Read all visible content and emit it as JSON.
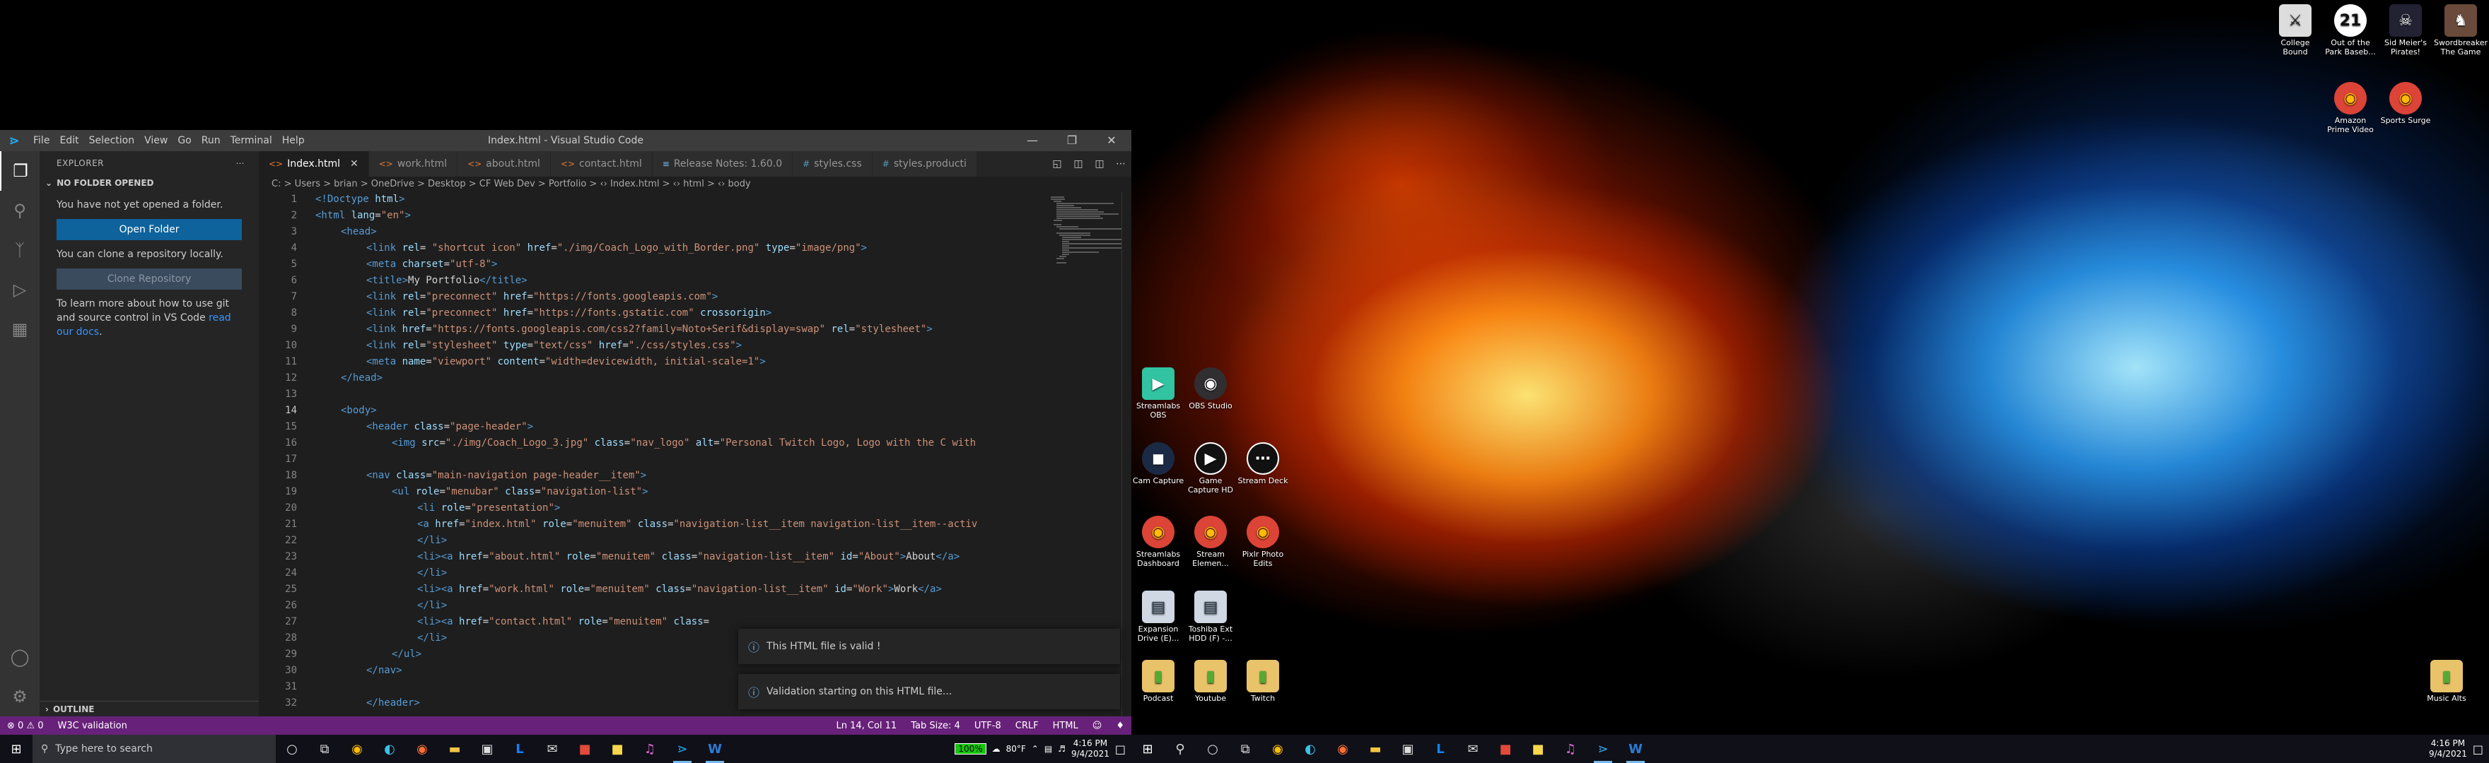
{
  "vscode": {
    "window_title": "Index.html - Visual Studio Code",
    "menu": [
      "File",
      "Edit",
      "Selection",
      "View",
      "Go",
      "Run",
      "Terminal",
      "Help"
    ],
    "explorer": {
      "header": "EXPLORER",
      "section": "NO FOLDER OPENED",
      "msg1": "You have not yet opened a folder.",
      "open_folder": "Open Folder",
      "msg2": "You can clone a repository locally.",
      "clone_repo": "Clone Repository",
      "msg3a": "To learn more about how to use git and source control in VS Code ",
      "msg3_link": "read our docs",
      "msg3b": ".",
      "outline": "OUTLINE"
    },
    "tabs": [
      {
        "label": "Index.html",
        "active": true
      },
      {
        "label": "work.html",
        "active": false
      },
      {
        "label": "about.html",
        "active": false
      },
      {
        "label": "contact.html",
        "active": false
      },
      {
        "label": "Release Notes: 1.60.0",
        "active": false
      },
      {
        "label": "styles.css",
        "active": false
      },
      {
        "label": "styles.producti",
        "active": false
      }
    ],
    "breadcrumb": "C: > Users > brian > OneDrive > Desktop > CF Web Dev > Portfolio > ‹› Index.html > ‹› html > ‹› body",
    "line_numbers": [
      "1",
      "2",
      "3",
      "4",
      "5",
      "6",
      "7",
      "8",
      "9",
      "10",
      "11",
      "12",
      "13",
      "14",
      "15",
      "16",
      "17",
      "18",
      "19",
      "20",
      "21",
      "22",
      "23",
      "24",
      "25",
      "26",
      "27",
      "28",
      "29",
      "30",
      "31",
      "32"
    ],
    "toasts": [
      "This HTML file is valid !",
      "Validation starting on this HTML file..."
    ],
    "status": {
      "problems": "⊗ 0 ⚠ 0",
      "w3c": "W3C validation",
      "position": "Ln 14, Col 11",
      "tab_size": "Tab Size: 4",
      "encoding": "UTF-8",
      "eol": "CRLF",
      "language": "HTML"
    }
  },
  "taskbar": {
    "search_placeholder": "Type here to search",
    "battery": "100%",
    "weather": "80°F",
    "time": "4:16 PM",
    "date": "9/4/2021"
  },
  "desktop_icons_top": [
    {
      "label": "College Bound"
    },
    {
      "label": "Out of the Park Baseb...",
      "badge": "21"
    },
    {
      "label": "Sid Meier's Pirates!"
    },
    {
      "label": "Swordbreaker The Game"
    },
    {
      "label": "Amazon Prime Video"
    },
    {
      "label": "Sports Surge"
    }
  ],
  "desktop_icons_left": [
    {
      "label": "Streamlabs OBS"
    },
    {
      "label": "OBS Studio"
    },
    {
      "label": "Cam Capture"
    },
    {
      "label": "Game Capture HD"
    },
    {
      "label": "Stream Deck"
    },
    {
      "label": "Streamlabs Dashboard"
    },
    {
      "label": "Stream Elemen..."
    },
    {
      "label": "Pixlr Photo Edits"
    },
    {
      "label": "Expansion Drive (E)..."
    },
    {
      "label": "Toshiba Ext HDD (F) -..."
    },
    {
      "label": "Podcast"
    },
    {
      "label": "Youtube"
    },
    {
      "label": "Twitch"
    }
  ],
  "desktop_icon_music": {
    "label": "Music Alts"
  },
  "colors": {
    "statusbar": "#68217a",
    "accent": "#0e639c",
    "link": "#3794ff"
  }
}
